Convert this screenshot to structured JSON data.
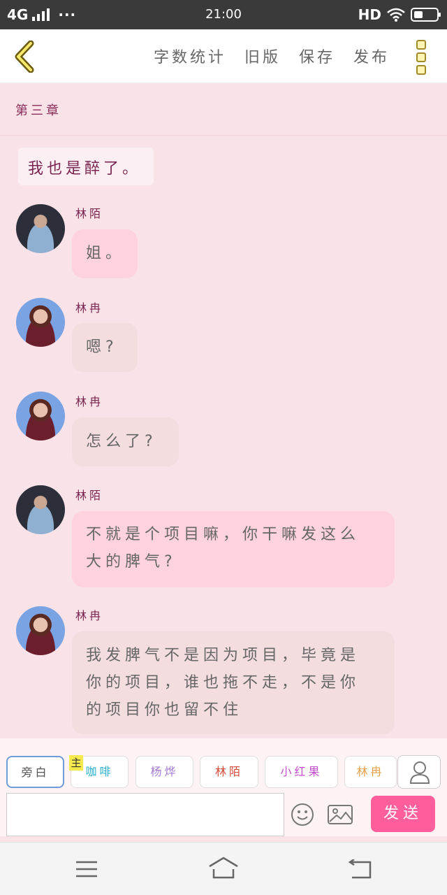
{
  "status_bar": {
    "network": "4G",
    "time": "21:00",
    "hd": "HD",
    "more": "···"
  },
  "toolbar": {
    "word_count": "字数统计",
    "old_version": "旧版",
    "save": "保存",
    "publish": "发布"
  },
  "chapter": "第三章",
  "narration": "我也是醉了。",
  "messages": [
    {
      "speaker": "林陌",
      "avatar": "male",
      "text": [
        "姐。"
      ]
    },
    {
      "speaker": "林冉",
      "avatar": "female",
      "text": [
        "嗯?"
      ]
    },
    {
      "speaker": "林冉",
      "avatar": "female",
      "text": [
        "怎么了?"
      ]
    },
    {
      "speaker": "林陌",
      "avatar": "male",
      "text": [
        "不就是个项目嘛，你干嘛发这么",
        "大的脾气?"
      ]
    },
    {
      "speaker": "林冉",
      "avatar": "female",
      "text": [
        "我发脾气不是因为项目，毕竟是",
        "你的项目，谁也拖不走，不是你",
        "的项目你也留不住"
      ]
    }
  ],
  "roles": {
    "tag": "主",
    "items": [
      {
        "label": "旁白",
        "color": "#555555"
      },
      {
        "label": "咖啡",
        "color": "#28b0c8"
      },
      {
        "label": "杨烨",
        "color": "#a27bd1"
      },
      {
        "label": "林陌",
        "color": "#d44a3a"
      },
      {
        "label": "小红果",
        "color": "#c24fcb"
      },
      {
        "label": "林冉",
        "color": "#e6a24a"
      }
    ]
  },
  "composer": {
    "placeholder": "",
    "send": "发送"
  },
  "icons": [
    "back-chevron-icon",
    "more-menu-icon",
    "emoji-icon",
    "image-icon",
    "person-icon",
    "nav-menu-icon",
    "nav-home-icon",
    "nav-back-icon"
  ]
}
